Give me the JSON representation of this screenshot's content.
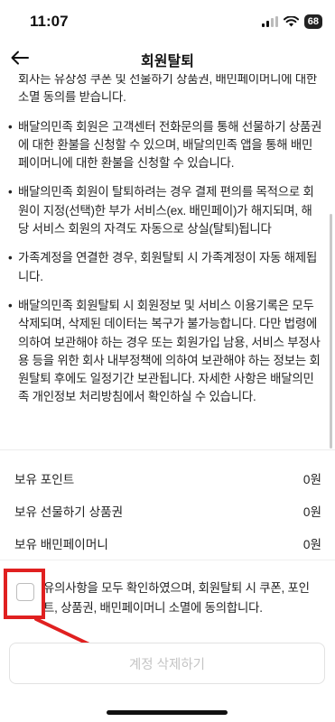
{
  "status_bar": {
    "time": "11:07",
    "battery": "68"
  },
  "header": {
    "title": "회원탈퇴",
    "back_icon": "arrow-left-icon"
  },
  "notice": {
    "items": [
      {
        "text": "회사는 유상성 쿠폰 및 선물하기 상품권, 배민페이머니에 대한 소멸 동의를 받습니다.",
        "bullet": false
      },
      {
        "text": "배달의민족 회원은 고객센터 전화문의를 통해 선물하기 상품권에 대한 환불을 신청할 수 있으며, 배달의민족 앱을 통해 배민페이머니에 대한 환불을 신청할 수 있습니다.",
        "bullet": true
      },
      {
        "text": "배달의민족 회원이 탈퇴하려는 경우 결제 편의를 목적으로 회원이 지정(선택)한 부가 서비스(ex. 배민페이)가 해지되며, 해당 서비스 회원의 자격도 자동으로 상실(탈퇴)됩니다",
        "bullet": true
      },
      {
        "text": "가족계정을 연결한 경우, 회원탈퇴 시 가족계정이 자동 해제됩니다.",
        "bullet": true
      },
      {
        "text": "배달의민족 회원탈퇴 시 회원정보 및 서비스 이용기록은 모두 삭제되며, 삭제된 데이터는 복구가 불가능합니다. 다만 법령에 의하여 보관해야 하는 경우 또는 회원가입 남용, 서비스 부정사용 등을 위한 회사 내부정책에 의하여 보관해야 하는 정보는 회원탈퇴 후에도 일정기간 보관됩니다. 자세한 사항은 배달의민족 개인정보 처리방침에서 확인하실 수 있습니다.",
        "bullet": true
      }
    ]
  },
  "balances": [
    {
      "label": "보유 포인트",
      "value": "0원"
    },
    {
      "label": "보유 선물하기 상품권",
      "value": "0원"
    },
    {
      "label": "보유 배민페이머니",
      "value": "0원"
    }
  ],
  "consent": {
    "text": "유의사항을 모두 확인하였으며, 회원탈퇴 시 쿠폰, 포인트, 상품권, 배민페이머니 소멸에 동의합니다.",
    "checked": false
  },
  "delete_button": {
    "label": "계정 삭제하기"
  },
  "colors": {
    "annotation": "#e02020",
    "disabled_text": "#c4c4c4"
  }
}
